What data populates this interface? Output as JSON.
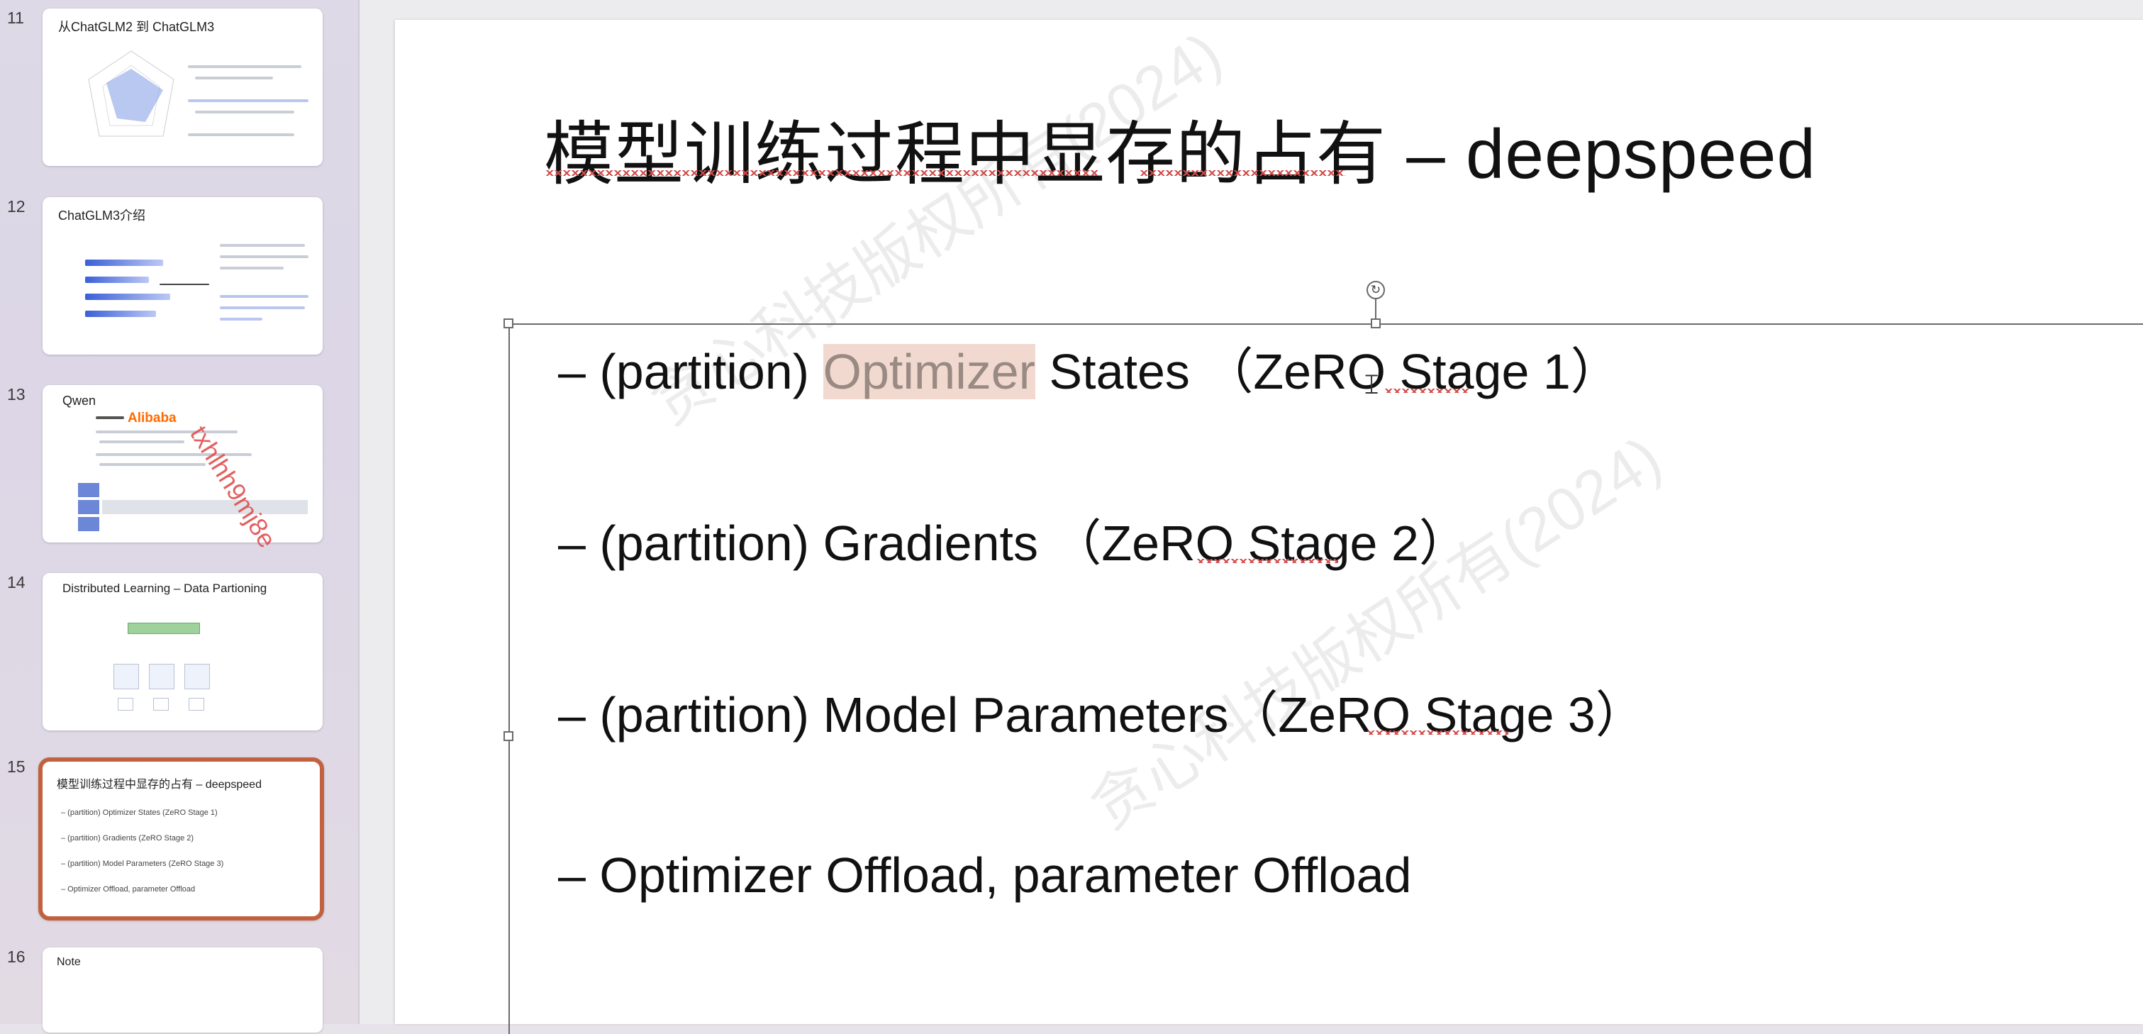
{
  "sidebar": {
    "slides": [
      {
        "number": "11",
        "title": "从ChatGLM2 到 ChatGLM3"
      },
      {
        "number": "12",
        "title": "ChatGLM3介绍"
      },
      {
        "number": "13",
        "title": "Qwen",
        "creator_logo": "Alibaba"
      },
      {
        "number": "14",
        "title": "Distributed Learning  – Data Partioning"
      },
      {
        "number": "15",
        "title": "模型训练过程中显存的占有 – deepspeed",
        "lines": [
          "– (partition) Optimizer States   (ZeRO Stage 1)",
          "– (partition) Gradients   (ZeRO Stage 2)",
          "– (partition) Model Parameters  (ZeRO Stage 3)",
          "– Optimizer Offload, parameter Offload"
        ]
      },
      {
        "number": "16",
        "title": "Note"
      }
    ]
  },
  "slide": {
    "title": "模型训练过程中显存的占有 – deepspeed",
    "bullets": [
      {
        "dash": "–",
        "before": "(partition) ",
        "highlight": "Optimizer",
        "after": " States  （ZeRO Stage 1）"
      },
      {
        "dash": "–",
        "text": "(partition) Gradients  （ZeRO Stage 2）"
      },
      {
        "dash": "–",
        "text": "(partition) Model Parameters（ZeRO Stage 3）"
      },
      {
        "dash": "–",
        "text": "Optimizer Offload, parameter Offload"
      }
    ],
    "watermark_text": "贪心科技版权所有(2024)",
    "watermark_user": "txhlhh9mj8e"
  },
  "colors": {
    "selection_border": "#c2613f",
    "text_highlight": "#f1d9cf"
  }
}
